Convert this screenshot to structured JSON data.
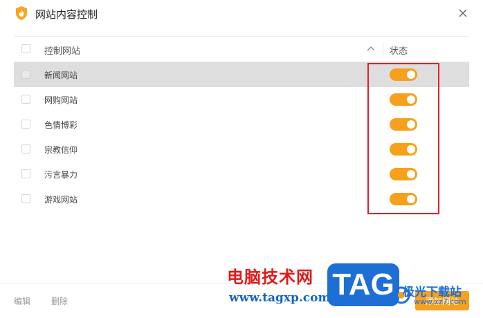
{
  "window": {
    "title": "网站内容控制"
  },
  "table": {
    "header": {
      "name": "控制网站",
      "status": "状态"
    },
    "rows": [
      {
        "label": "新闻网站",
        "enabled": true,
        "selected": true
      },
      {
        "label": "网购网站",
        "enabled": true,
        "selected": false
      },
      {
        "label": "色情博彩",
        "enabled": true,
        "selected": false
      },
      {
        "label": "宗教信仰",
        "enabled": true,
        "selected": false
      },
      {
        "label": "污言暴力",
        "enabled": true,
        "selected": false
      },
      {
        "label": "游戏网站",
        "enabled": true,
        "selected": false
      }
    ]
  },
  "footer": {
    "edit": "编辑",
    "delete": "删除",
    "add": "添加网站"
  },
  "watermark": {
    "cn": "电脑技术网",
    "url": "www.tagxp.com",
    "tag": "TAG",
    "jg": "极光下载站",
    "jg_url": "www.xz7.com"
  },
  "colors": {
    "accent": "#f7a01d",
    "highlight": "#e0202a",
    "selected_row": "#dedede"
  },
  "icons": {
    "app": "shield-flame-icon",
    "close": "close-icon",
    "sort": "chevron-up-icon"
  }
}
